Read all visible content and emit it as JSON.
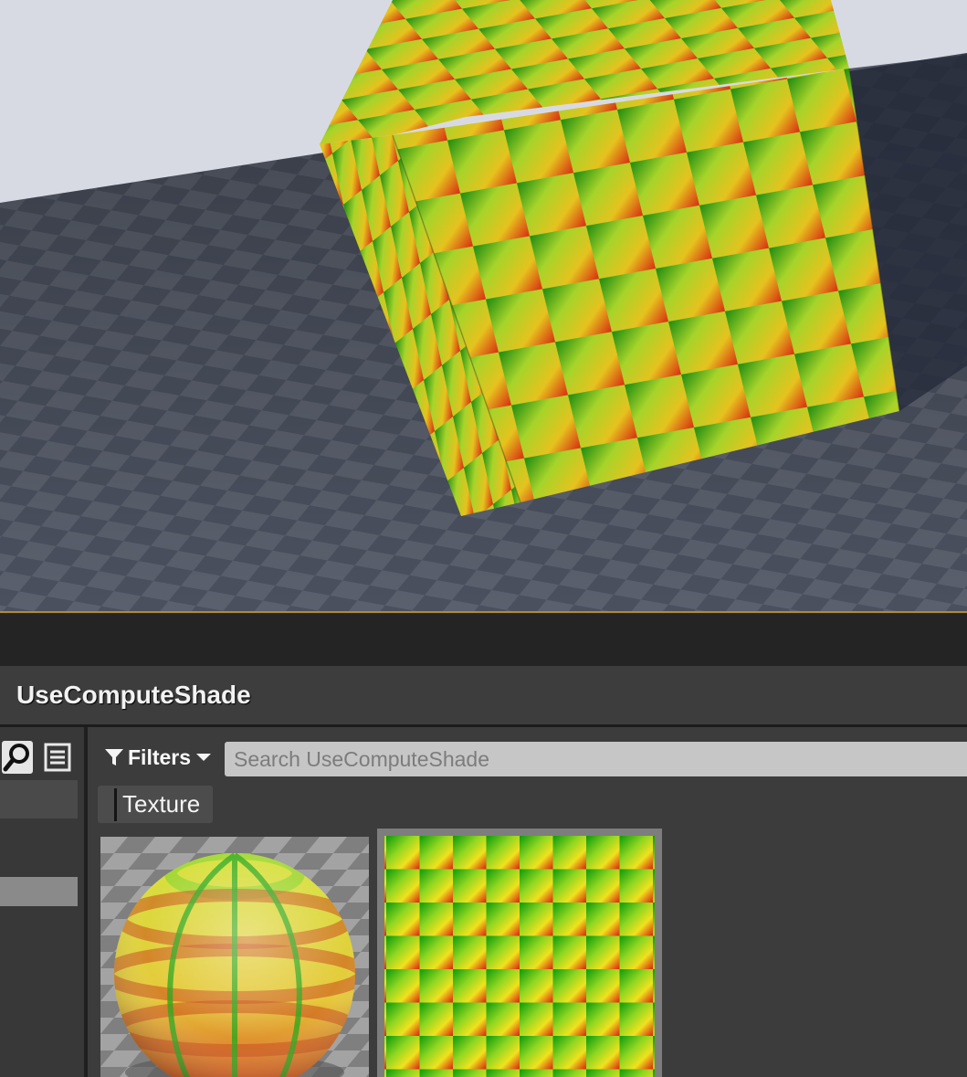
{
  "viewport": {
    "sky_color": "#d9dbe4",
    "floor_color": "#454b59",
    "cube_pattern": "red-green gradient checker",
    "border_color": "#b08a3a"
  },
  "content_browser": {
    "title": "UseComputeShade",
    "toolbar": {
      "search_toggle_icon": "search-icon",
      "list_toggle_icon": "list-view-icon",
      "filters_label": "Filters",
      "filters_icon": "filter-icon",
      "filters_dropdown_icon": "caret-down-icon",
      "search_placeholder": "Search UseComputeShade"
    },
    "active_filters": [
      {
        "label": "Texture"
      }
    ],
    "assets": [
      {
        "kind": "material",
        "thumbnail": "checker-sphere"
      },
      {
        "kind": "texture",
        "thumbnail": "gradient-checker-grid"
      }
    ]
  }
}
